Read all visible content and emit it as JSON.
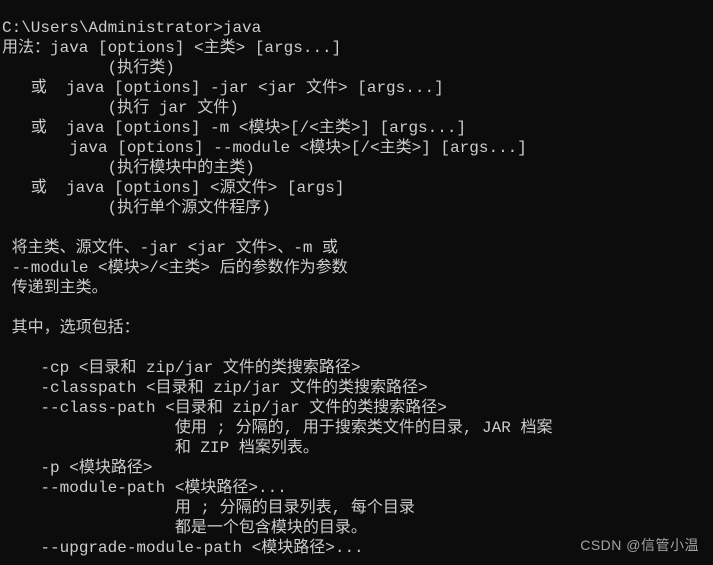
{
  "prompt": "C:\\Users\\Administrator>java",
  "lines": [
    "用法：java [options] <主类> [args...]",
    "           (执行类)",
    "   或  java [options] -jar <jar 文件> [args...]",
    "           (执行 jar 文件)",
    "   或  java [options] -m <模块>[/<主类>] [args...]",
    "       java [options] --module <模块>[/<主类>] [args...]",
    "           (执行模块中的主类)",
    "   或  java [options] <源文件> [args]",
    "           (执行单个源文件程序)",
    "",
    " 将主类、源文件、-jar <jar 文件>、-m 或",
    " --module <模块>/<主类> 后的参数作为参数",
    " 传递到主类。",
    "",
    " 其中，选项包括：",
    "",
    "    -cp <目录和 zip/jar 文件的类搜索路径>",
    "    -classpath <目录和 zip/jar 文件的类搜索路径>",
    "    --class-path <目录和 zip/jar 文件的类搜索路径>",
    "                  使用 ; 分隔的, 用于搜索类文件的目录, JAR 档案",
    "                  和 ZIP 档案列表。",
    "    -p <模块路径>",
    "    --module-path <模块路径>...",
    "                  用 ; 分隔的目录列表, 每个目录",
    "                  都是一个包含模块的目录。",
    "    --upgrade-module-path <模块路径>..."
  ],
  "watermark": "CSDN @信管小温"
}
